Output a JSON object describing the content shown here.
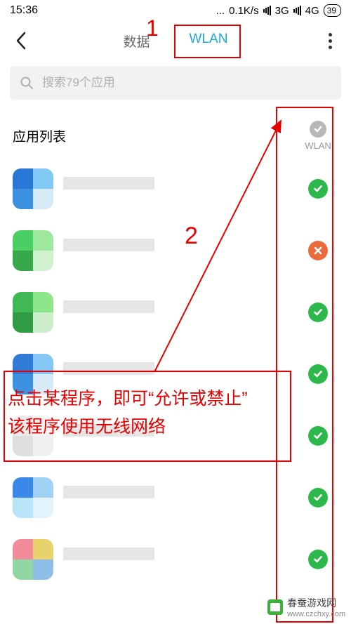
{
  "status": {
    "time": "15:36",
    "dots": "...",
    "net_speed": "0.1K/s",
    "net_3g": "3G",
    "net_4g": "4G",
    "battery": "39"
  },
  "tabs": {
    "data": "数据",
    "wlan": "WLAN"
  },
  "search": {
    "placeholder": "搜索79个应用"
  },
  "list": {
    "title": "应用列表",
    "column_label": "WLAN"
  },
  "apps": [
    {
      "icon_colors": [
        "#2a78d6",
        "#7fc9f4",
        "#3c90e0",
        "#d6e9f7"
      ],
      "status": "allow"
    },
    {
      "icon_colors": [
        "#4bcf63",
        "#9ee89c",
        "#39a84a",
        "#d1f2d0"
      ],
      "status": "deny"
    },
    {
      "icon_colors": [
        "#3fb855",
        "#8de68a",
        "#2f9c44",
        "#cdeccc"
      ],
      "status": "allow"
    },
    {
      "icon_colors": [
        "#2f7bd6",
        "#84c6f5",
        "#3c92e0",
        "#d7eaf8"
      ],
      "status": "allow"
    },
    {
      "icon_colors": [
        "#eaeaea",
        "#f4f4f4",
        "#dedede",
        "#f0f0f0"
      ],
      "status": "allow"
    },
    {
      "icon_colors": [
        "#3a89e8",
        "#9fd2f5",
        "#b7e4f7",
        "#e2f3fb"
      ],
      "status": "allow"
    },
    {
      "icon_colors": [
        "#f28b99",
        "#e8d26b",
        "#8fd6a2",
        "#8fbfe8"
      ],
      "status": "allow"
    }
  ],
  "annotations": {
    "label_1": "1",
    "label_2": "2",
    "instruction_line1": "点击某程序，即可“允许或禁止”",
    "instruction_line2": "该程序使用无线网络"
  },
  "watermark": {
    "site": "春蚕游戏网",
    "url": "www.czchxy.com"
  }
}
